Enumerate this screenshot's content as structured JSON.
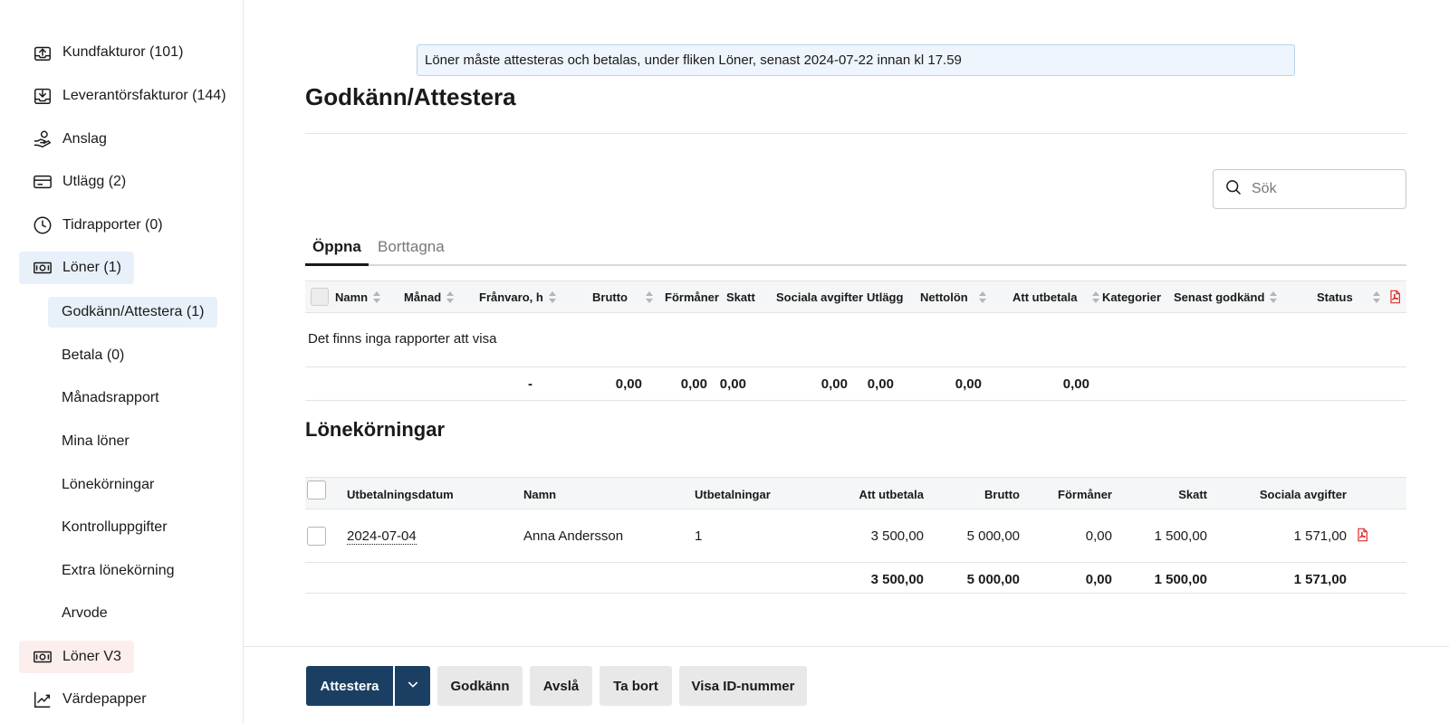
{
  "sidebar": {
    "items": [
      {
        "label": "Kundfakturor (101)",
        "icon": "invoice-out-icon"
      },
      {
        "label": "Leverantörsfakturor (144)",
        "icon": "invoice-in-icon"
      },
      {
        "label": "Anslag",
        "icon": "hand-coins-icon"
      },
      {
        "label": "Utlägg (2)",
        "icon": "card-icon"
      },
      {
        "label": "Tidrapporter (0)",
        "icon": "clock-icon"
      },
      {
        "label": "Löner (1)",
        "icon": "money-icon"
      },
      {
        "label": "Löner V3",
        "icon": "money-icon"
      },
      {
        "label": "Värdepapper",
        "icon": "chart-line-icon"
      }
    ],
    "sub_items": [
      {
        "label": "Godkänn/Attestera (1)"
      },
      {
        "label": "Betala (0)"
      },
      {
        "label": "Månadsrapport"
      },
      {
        "label": "Mina löner"
      },
      {
        "label": "Lönekörningar"
      },
      {
        "label": "Kontrolluppgifter"
      },
      {
        "label": "Extra lönekörning"
      },
      {
        "label": "Arvode"
      }
    ]
  },
  "banner": {
    "text": "Löner måste attesteras och betalas, under fliken Löner, senast 2024-07-22 innan kl 17.59"
  },
  "page": {
    "title": "Godkänn/Attestera"
  },
  "search": {
    "placeholder": "Sök"
  },
  "tabs": [
    {
      "label": "Öppna"
    },
    {
      "label": "Borttagna"
    }
  ],
  "reports_table": {
    "headers": [
      "Namn",
      "Månad",
      "Frånvaro, h",
      "Brutto",
      "Förmåner",
      "Skatt",
      "Sociala avgifter",
      "Utlägg",
      "Nettolön",
      "Att utbetala",
      "Kategorier",
      "Senast godkänd",
      "Status"
    ],
    "empty_message": "Det finns inga rapporter att visa",
    "totals": {
      "franvaro": "-",
      "brutto": "0,00",
      "formaner": "0,00",
      "skatt": "0,00",
      "sociala": "0,00",
      "utlagg": "0,00",
      "nettolon": "0,00",
      "att_utbetala": "0,00"
    }
  },
  "payroll_section": {
    "title": "Lönekörningar"
  },
  "payroll_table": {
    "headers": [
      "Utbetalningsdatum",
      "Namn",
      "Utbetalningar",
      "Att utbetala",
      "Brutto",
      "Förmåner",
      "Skatt",
      "Sociala avgifter"
    ],
    "rows": [
      {
        "date": "2024-07-04",
        "name": "Anna Andersson",
        "count": "1",
        "att_utbetala": "3 500,00",
        "brutto": "5 000,00",
        "formaner": "0,00",
        "skatt": "1 500,00",
        "sociala": "1 571,00"
      }
    ],
    "totals": {
      "att_utbetala": "3 500,00",
      "brutto": "5 000,00",
      "formaner": "0,00",
      "skatt": "1 500,00",
      "sociala": "1 571,00"
    }
  },
  "footer": {
    "attest_label": "Attestera",
    "approve_label": "Godkänn",
    "reject_label": "Avslå",
    "delete_label": "Ta bort",
    "show_id_label": "Visa ID-nummer"
  },
  "colors": {
    "primary": "#1b3f63",
    "active_nav": "#e8f1fa",
    "active_nav_v3": "#fdeeee",
    "pdf": "#e02b2b",
    "banner_bg": "#eef5fc"
  }
}
